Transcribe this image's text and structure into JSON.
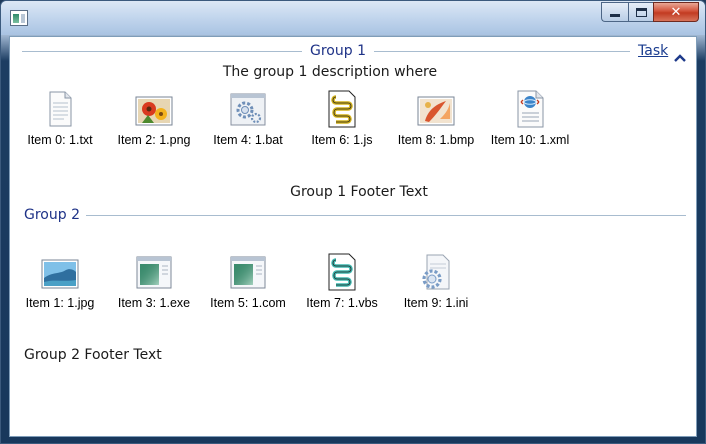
{
  "window": {
    "caption": {
      "minimize": "",
      "maximize": "",
      "close": "✕"
    }
  },
  "groups": [
    {
      "header": "Group 1",
      "description": "The group 1 description where",
      "footer": "Group 1 Footer Text",
      "task": "Task",
      "items": [
        {
          "label": "Item 0: 1.txt",
          "icon": "text-file-icon"
        },
        {
          "label": "Item 2: 1.png",
          "icon": "image-flowers-icon"
        },
        {
          "label": "Item 4: 1.bat",
          "icon": "batch-gear-icon"
        },
        {
          "label": "Item 6: 1.js",
          "icon": "script-icon"
        },
        {
          "label": "Item 8: 1.bmp",
          "icon": "paint-icon"
        },
        {
          "label": "Item 10: 1.xml",
          "icon": "xml-document-icon"
        }
      ]
    },
    {
      "header": "Group 2",
      "footer": "Group 2 Footer Text",
      "items": [
        {
          "label": "Item 1: 1.jpg",
          "icon": "landscape-image-icon"
        },
        {
          "label": "Item 3: 1.exe",
          "icon": "executable-window-icon"
        },
        {
          "label": "Item 5: 1.com",
          "icon": "executable-window-icon"
        },
        {
          "label": "Item 7: 1.vbs",
          "icon": "script-icon"
        },
        {
          "label": "Item 9: 1.ini",
          "icon": "settings-file-icon"
        }
      ]
    }
  ],
  "colors": {
    "header_text": "#1e3287",
    "link": "#1a3c8f",
    "separator": "#a8bccf"
  }
}
